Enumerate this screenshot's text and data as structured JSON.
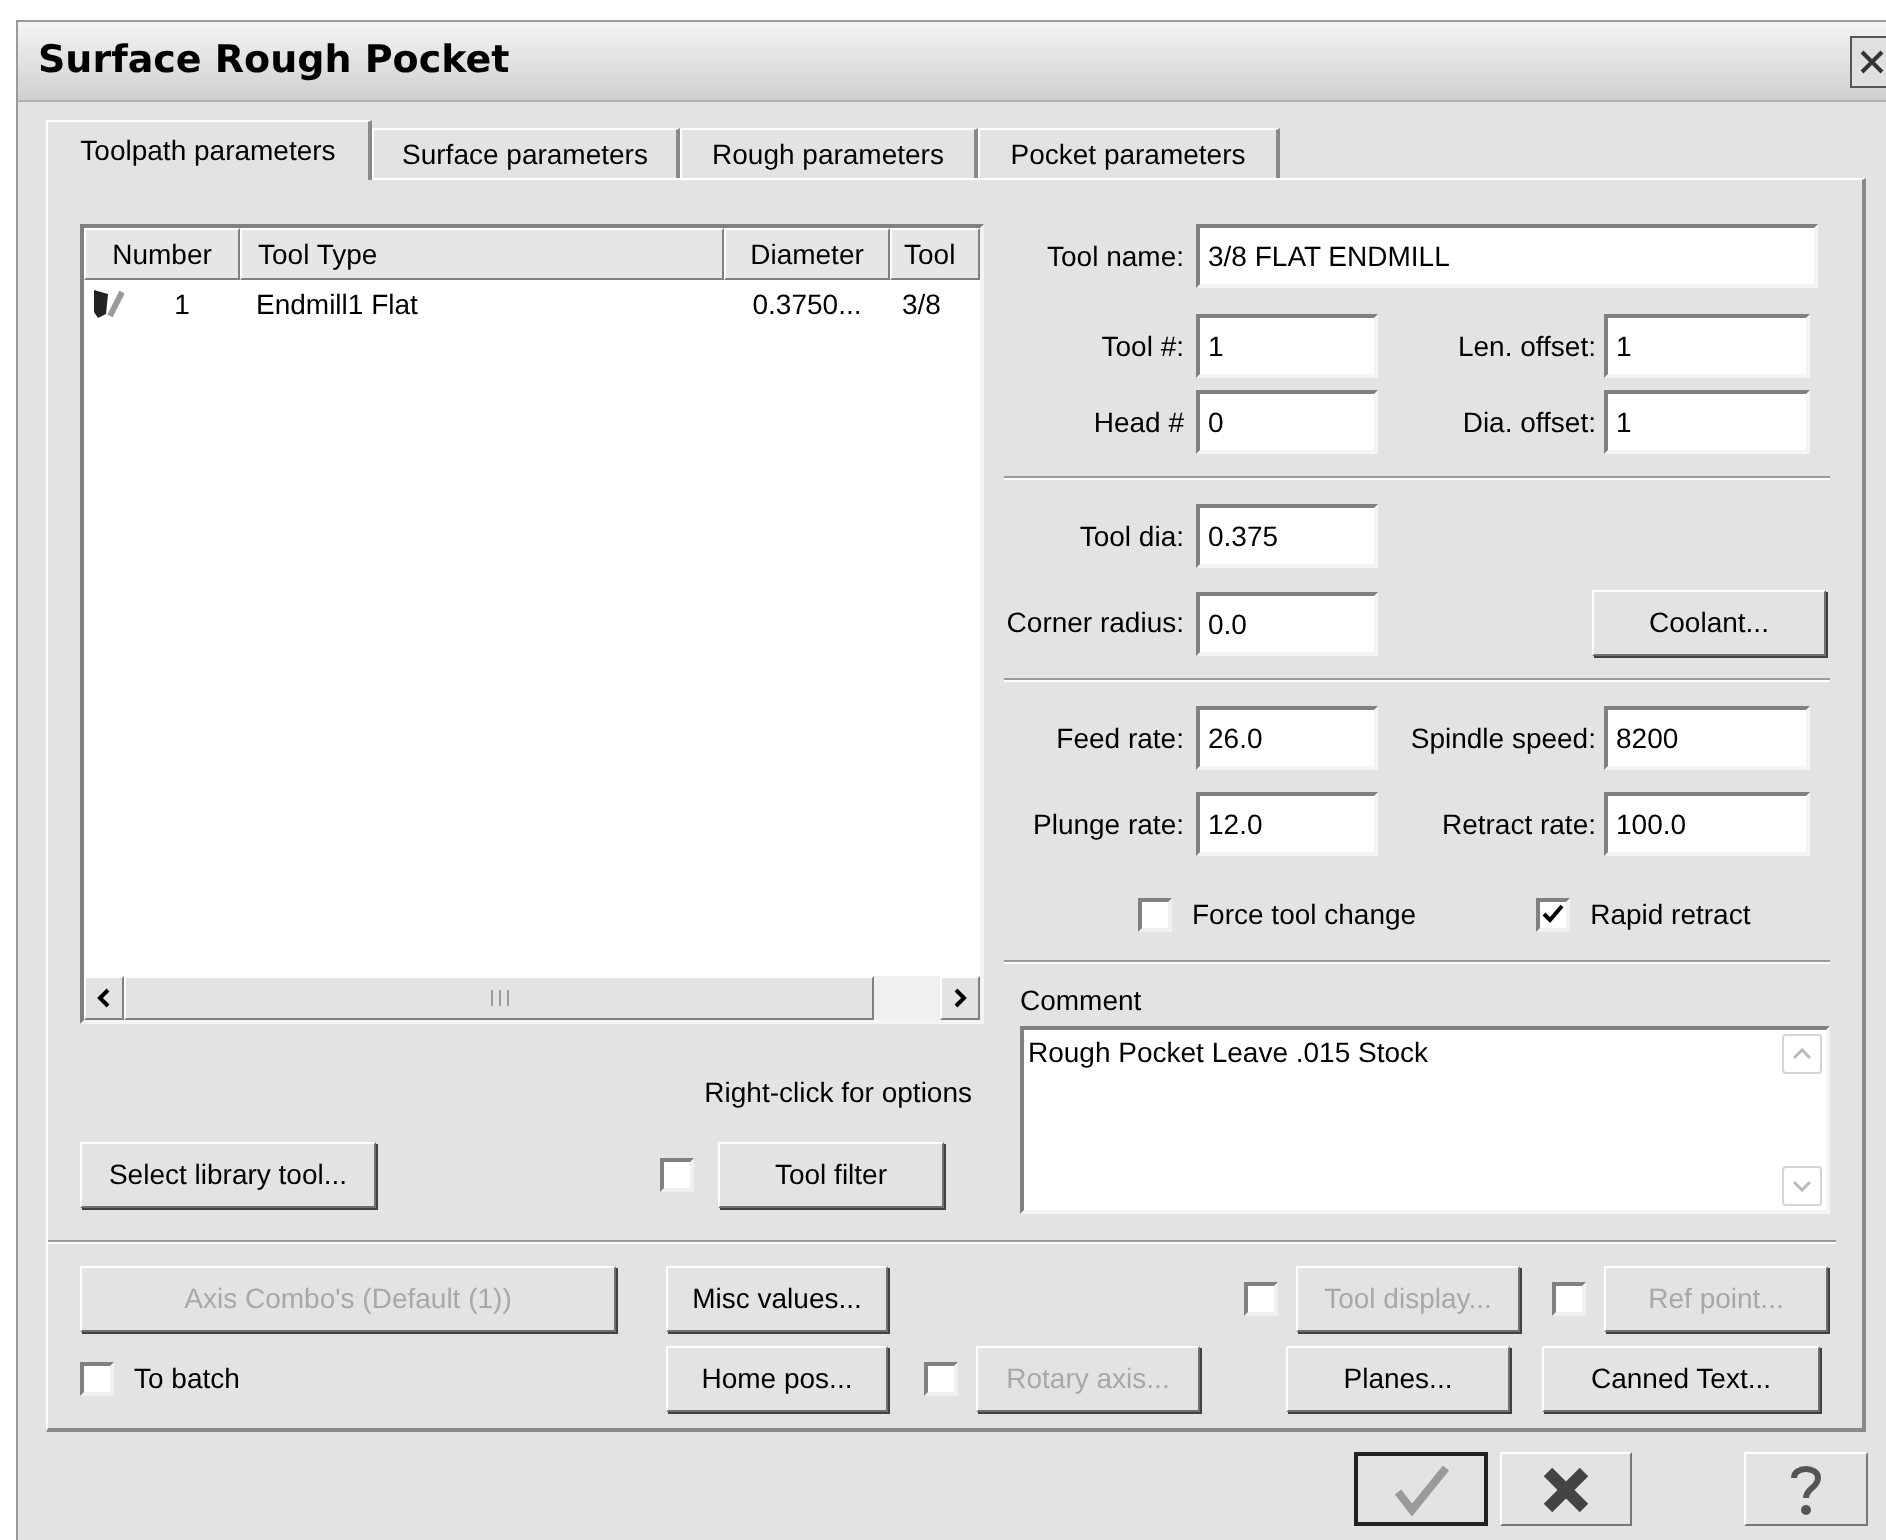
{
  "window": {
    "title": "Surface Rough Pocket"
  },
  "tabs": [
    {
      "label": "Toolpath parameters",
      "selected": true
    },
    {
      "label": "Surface parameters",
      "selected": false
    },
    {
      "label": "Rough parameters",
      "selected": false
    },
    {
      "label": "Pocket parameters",
      "selected": false
    }
  ],
  "tool_list": {
    "columns": [
      "Number",
      "Tool Type",
      "Diameter",
      "Tool"
    ],
    "rows": [
      {
        "cells": [
          "1",
          "Endmill1 Flat",
          "0.3750...",
          "3/8"
        ]
      }
    ]
  },
  "list_hint": "Right-click for options",
  "select_library_button": "Select library tool...",
  "tool_filter": {
    "label": "Tool filter",
    "checked": false
  },
  "tool_name": {
    "label": "Tool name:",
    "value": "3/8 FLAT ENDMILL"
  },
  "field_rows": [
    [
      {
        "label": "Tool #:",
        "value": "1"
      },
      {
        "label": "Len. offset:",
        "value": "1"
      }
    ],
    [
      {
        "label": "Head #",
        "value": "0"
      },
      {
        "label": "Dia. offset:",
        "value": "1"
      }
    ],
    [
      {
        "label": "Tool dia:",
        "value": "0.375"
      }
    ],
    [
      {
        "label": "Corner radius:",
        "value": "0.0"
      }
    ],
    [
      {
        "label": "Feed rate:",
        "value": "26.0"
      },
      {
        "label": "Spindle speed:",
        "value": "8200"
      }
    ],
    [
      {
        "label": "Plunge rate:",
        "value": "12.0"
      },
      {
        "label": "Retract rate:",
        "value": "100.0"
      }
    ]
  ],
  "coolant_button": "Coolant...",
  "options": [
    {
      "label": "Force tool change",
      "checked": false
    },
    {
      "label": "Rapid retract",
      "checked": true
    }
  ],
  "comment": {
    "label": "Comment",
    "value": "Rough Pocket Leave .015 Stock"
  },
  "bottom_rows": [
    [
      {
        "kind": "button",
        "label": "Axis Combo's (Default (1))",
        "disabled": true
      },
      {
        "kind": "button",
        "label": "Misc values...",
        "disabled": false
      },
      {
        "kind": "check_button",
        "label": "Tool display...",
        "checked": false,
        "disabled": true
      },
      {
        "kind": "check_button",
        "label": "Ref point...",
        "checked": false,
        "disabled": true
      }
    ],
    [
      {
        "kind": "checkbox",
        "label": "To batch",
        "checked": false
      },
      {
        "kind": "button",
        "label": "Home pos...",
        "disabled": false
      },
      {
        "kind": "check_button",
        "label": "Rotary axis...",
        "checked": false,
        "disabled": true
      },
      {
        "kind": "button",
        "label": "Planes...",
        "disabled": false
      },
      {
        "kind": "button",
        "label": "Canned Text...",
        "disabled": false
      }
    ]
  ]
}
